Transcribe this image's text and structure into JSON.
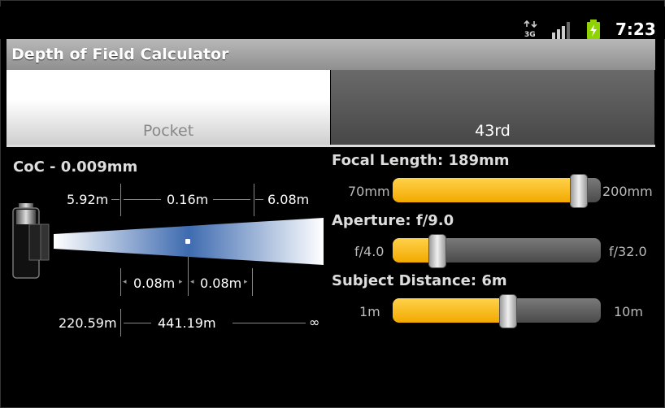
{
  "status": {
    "time": "7:23",
    "network_icon": "3g-icon",
    "signal_icon": "signal-icon",
    "battery_icon": "battery-charging-icon"
  },
  "app": {
    "title": "Depth of Field Calculator"
  },
  "tabs": [
    {
      "label": "Pocket",
      "selected": false
    },
    {
      "label": "43rd",
      "selected": true
    }
  ],
  "diagram": {
    "coc": "CoC - 0.009mm",
    "near_limit": "5.92m",
    "dof_total": "0.16m",
    "far_limit": "6.08m",
    "front_dof": "0.08m",
    "rear_dof": "0.08m",
    "hyperfocal": "220.59m",
    "hyperfocal_range": "441.19m",
    "infinity": "∞"
  },
  "sliders": {
    "focal": {
      "label": "Focal Length: 189mm",
      "min": "70mm",
      "max": "200mm",
      "level": 0.89
    },
    "aperture": {
      "label": "Aperture: f/9.0",
      "min": "f/4.0",
      "max": "f/32.0",
      "level": 0.21
    },
    "distance": {
      "label": "Subject Distance: 6m",
      "min": "1m",
      "max": "10m",
      "level": 0.55
    }
  },
  "colors": {
    "accent": "#f5b400",
    "tab_selected": "#555555",
    "title_bar": "#a5a5a5"
  }
}
